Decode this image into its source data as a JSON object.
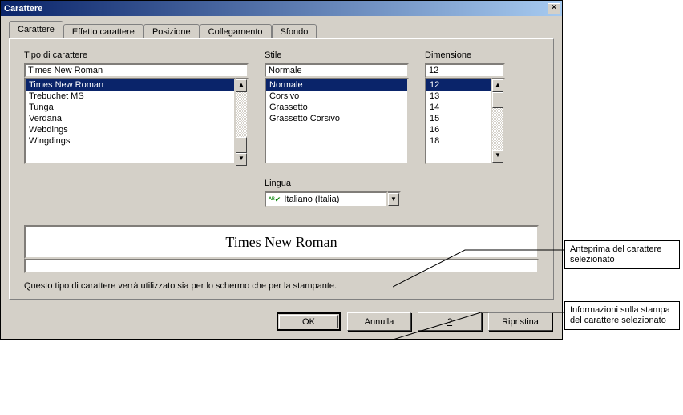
{
  "window": {
    "title": "Carattere"
  },
  "tabs": [
    {
      "label": "Carattere"
    },
    {
      "label": "Effetto carattere"
    },
    {
      "label": "Posizione"
    },
    {
      "label": "Collegamento"
    },
    {
      "label": "Sfondo"
    }
  ],
  "labels": {
    "font": "Tipo di carattere",
    "style": "Stile",
    "size": "Dimensione",
    "language": "Lingua"
  },
  "font": {
    "value": "Times New Roman",
    "items": [
      "Times New Roman",
      "Trebuchet MS",
      "Tunga",
      "Verdana",
      "Webdings",
      "Wingdings"
    ]
  },
  "style": {
    "value": "Normale",
    "items": [
      "Normale",
      "Corsivo",
      "Grassetto",
      "Grassetto Corsivo"
    ]
  },
  "size": {
    "value": "12",
    "items": [
      "12",
      "13",
      "14",
      "15",
      "16",
      "18"
    ]
  },
  "language": {
    "value": "Italiano (Italia)"
  },
  "preview": {
    "text": "Times New Roman"
  },
  "info": {
    "text": "Questo tipo di carattere verrà utilizzato sia per lo schermo che per la stampante."
  },
  "buttons": {
    "ok": "OK",
    "cancel": "Annulla",
    "help": "?",
    "reset": "Ripristina"
  },
  "callouts": {
    "preview": "Anteprima del carattere selezionato",
    "printinfo": "Informazioni sulla stampa del carattere selezionato"
  }
}
